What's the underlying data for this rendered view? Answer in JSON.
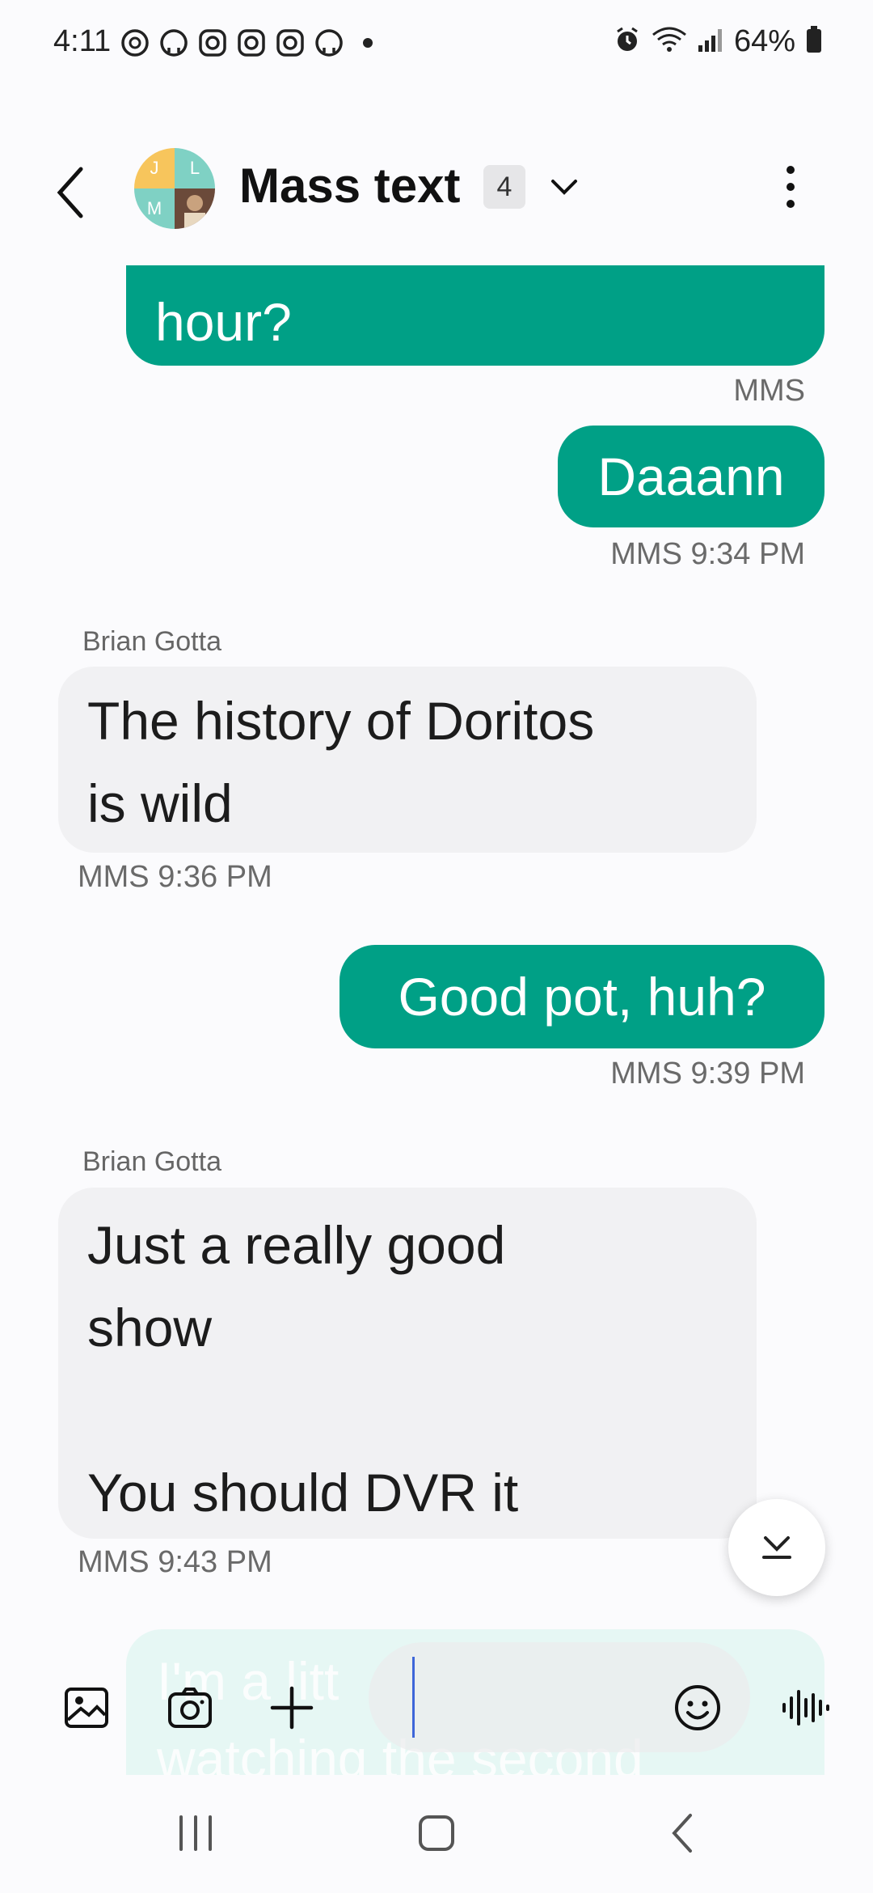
{
  "status_bar": {
    "time": "4:11",
    "battery": "64%",
    "notification_icons": [
      "threads-icon",
      "github-icon",
      "instagram-icon",
      "instagram-icon",
      "instagram-icon",
      "github-icon",
      "dot-icon"
    ]
  },
  "header": {
    "title": "Mass text",
    "participant_count": "4",
    "avatar_initials": [
      "J",
      "L",
      "M"
    ]
  },
  "messages": [
    {
      "direction": "out",
      "text": "hour?",
      "meta": "MMS"
    },
    {
      "direction": "out",
      "text": "Daaann",
      "meta": "MMS 9:34 PM"
    },
    {
      "direction": "in",
      "sender": "Brian Gotta",
      "lines": [
        "The history of Doritos",
        "is wild"
      ],
      "meta": "MMS 9:36 PM"
    },
    {
      "direction": "out",
      "text": "Good pot, huh?",
      "meta": "MMS 9:39 PM"
    },
    {
      "direction": "in",
      "sender": "Brian Gotta",
      "lines": [
        "Just a really good",
        "show",
        "",
        "You should DVR it"
      ],
      "meta": "MMS 9:43 PM"
    }
  ],
  "draft_preview": {
    "lines": [
      "I'm a litt",
      "watching the second"
    ]
  },
  "composer": {
    "buttons": [
      "gallery-icon",
      "camera-icon",
      "plus-icon",
      "emoji-icon",
      "voice-icon"
    ]
  },
  "colors": {
    "outgoing_bubble": "#00a086",
    "incoming_bubble": "#f1f1f3",
    "cursor": "#3e66d9"
  }
}
